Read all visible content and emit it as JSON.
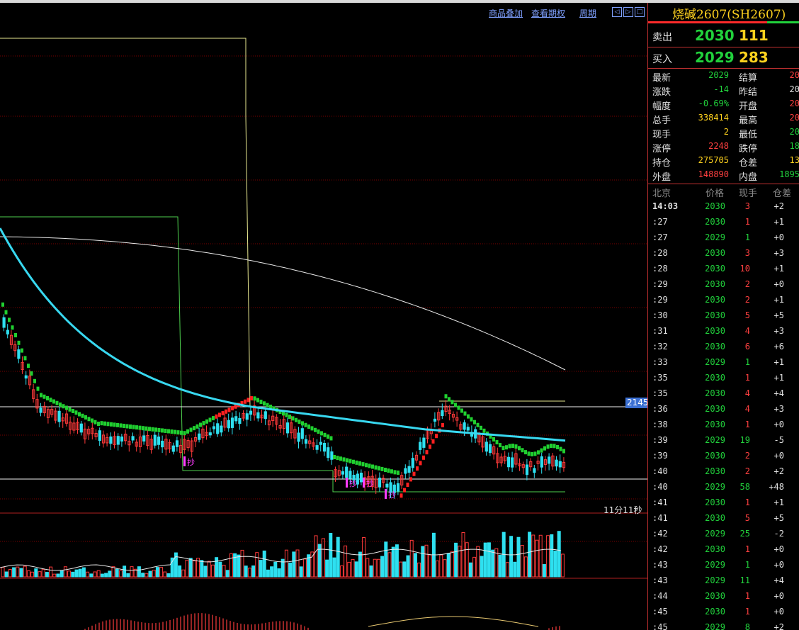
{
  "toolbar": {
    "overlay_label": "商品叠加",
    "options_label": "查看期权",
    "period_label": "周期",
    "nav_icons": [
      "arrow-left-icon",
      "arrow-right-icon",
      "window-icon"
    ]
  },
  "chart": {
    "price_tag": "2145",
    "countdown": "11分11秒",
    "markers": [
      "抄",
      "抄",
      "抄",
      "抄"
    ],
    "colors": {
      "up": "#ff3a3a",
      "down": "#2ee0f0",
      "ma_slow": "#e8e8e8",
      "ma_mid": "#38d8f0",
      "ribbon_up": "#ff2020",
      "ribbon_down": "#20d030",
      "box_yellow": "#e8e890",
      "box_green": "#4ed04e",
      "grid": "#7a0000",
      "marker": "#ff3cff"
    }
  },
  "panel": {
    "title": "烧碱2607(SH2607)",
    "sell_label": "卖出",
    "sell_price": "2030",
    "sell_volume": "111",
    "buy_label": "买入",
    "buy_price": "2029",
    "buy_volume": "283",
    "quote_rows": [
      {
        "l1": "最新",
        "v1": "2029",
        "c1": "#21d13c",
        "l2": "结算",
        "v2": "20",
        "c2": "#ff4040"
      },
      {
        "l1": "涨跌",
        "v1": "-14",
        "c1": "#21d13c",
        "l2": "昨结",
        "v2": "20",
        "c2": "#e0e0e0"
      },
      {
        "l1": "幅度",
        "v1": "-0.69%",
        "c1": "#21d13c",
        "l2": "开盘",
        "v2": "20",
        "c2": "#ff4040"
      },
      {
        "l1": "总手",
        "v1": "338414",
        "c1": "#ffd21e",
        "l2": "最高",
        "v2": "20",
        "c2": "#ff4040"
      },
      {
        "l1": "现手",
        "v1": "2",
        "c1": "#ffd21e",
        "l2": "最低",
        "v2": "20",
        "c2": "#21d13c"
      },
      {
        "l1": "涨停",
        "v1": "2248",
        "c1": "#ff4040",
        "l2": "跌停",
        "v2": "18",
        "c2": "#21d13c"
      },
      {
        "l1": "持仓",
        "v1": "275705",
        "c1": "#ffd21e",
        "l2": "仓差",
        "v2": "13",
        "c2": "#ffd21e"
      },
      {
        "l1": "外盘",
        "v1": "148890",
        "c1": "#ff4040",
        "l2": "内盘",
        "v2": "1895",
        "c2": "#21d13c"
      }
    ],
    "tick_header": {
      "time": "北京",
      "price": "价格",
      "volume": "现手",
      "oi": "仓差"
    },
    "ticks": [
      {
        "t": "14:03",
        "p": "2030",
        "v": "3",
        "oi": "+2"
      },
      {
        "t": ":27",
        "p": "2030",
        "v": "1",
        "oi": "+1"
      },
      {
        "t": ":27",
        "p": "2029",
        "v": "1",
        "oi": "+0"
      },
      {
        "t": ":28",
        "p": "2030",
        "v": "3",
        "oi": "+3"
      },
      {
        "t": ":28",
        "p": "2030",
        "v": "10",
        "oi": "+1"
      },
      {
        "t": ":29",
        "p": "2030",
        "v": "2",
        "oi": "+0"
      },
      {
        "t": ":29",
        "p": "2030",
        "v": "2",
        "oi": "+1"
      },
      {
        "t": ":30",
        "p": "2030",
        "v": "5",
        "oi": "+5"
      },
      {
        "t": ":31",
        "p": "2030",
        "v": "4",
        "oi": "+3"
      },
      {
        "t": ":32",
        "p": "2030",
        "v": "6",
        "oi": "+6"
      },
      {
        "t": ":33",
        "p": "2029",
        "v": "1",
        "oi": "+1"
      },
      {
        "t": ":35",
        "p": "2030",
        "v": "1",
        "oi": "+1"
      },
      {
        "t": ":35",
        "p": "2030",
        "v": "4",
        "oi": "+4"
      },
      {
        "t": ":36",
        "p": "2030",
        "v": "4",
        "oi": "+3"
      },
      {
        "t": ":38",
        "p": "2030",
        "v": "1",
        "oi": "+0"
      },
      {
        "t": ":39",
        "p": "2029",
        "v": "19",
        "oi": "-5"
      },
      {
        "t": ":39",
        "p": "2030",
        "v": "2",
        "oi": "+0"
      },
      {
        "t": ":40",
        "p": "2030",
        "v": "2",
        "oi": "+2"
      },
      {
        "t": ":40",
        "p": "2029",
        "v": "58",
        "oi": "+48"
      },
      {
        "t": ":41",
        "p": "2030",
        "v": "1",
        "oi": "+1"
      },
      {
        "t": ":41",
        "p": "2030",
        "v": "5",
        "oi": "+5"
      },
      {
        "t": ":42",
        "p": "2029",
        "v": "25",
        "oi": "-2"
      },
      {
        "t": ":42",
        "p": "2030",
        "v": "1",
        "oi": "+0"
      },
      {
        "t": ":43",
        "p": "2029",
        "v": "1",
        "oi": "+0"
      },
      {
        "t": ":43",
        "p": "2029",
        "v": "11",
        "oi": "+4"
      },
      {
        "t": ":44",
        "p": "2030",
        "v": "1",
        "oi": "+0"
      },
      {
        "t": ":45",
        "p": "2030",
        "v": "1",
        "oi": "+0"
      },
      {
        "t": ":45",
        "p": "2029",
        "v": "8",
        "oi": "+2"
      }
    ]
  }
}
